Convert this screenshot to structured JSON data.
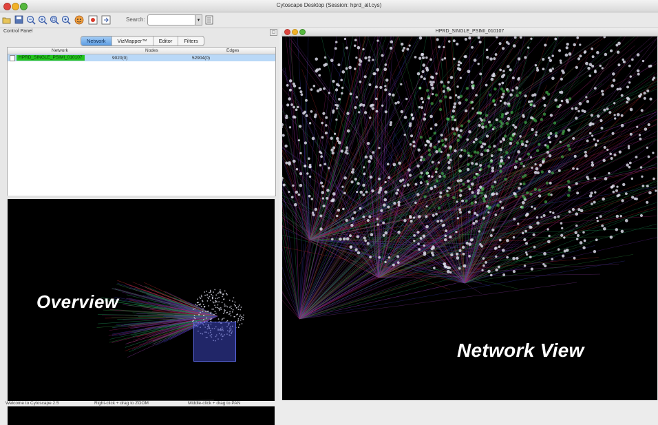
{
  "window": {
    "title": "Cytoscape Desktop (Session: hprd_all.cys)"
  },
  "toolbar": {
    "icons": [
      "open-folder-icon",
      "save-icon",
      "zoom-out-icon",
      "zoom-in-icon",
      "zoom-selected-icon",
      "zoom-fit-icon",
      "vizwiz-icon",
      "layout-icon",
      "export-icon"
    ],
    "search_label": "Search:",
    "search_value": ""
  },
  "control_panel": {
    "title": "Control Panel",
    "tabs": [
      {
        "label": "Network",
        "active": true
      },
      {
        "label": "VizMapper™",
        "active": false
      },
      {
        "label": "Editor",
        "active": false
      },
      {
        "label": "Filters",
        "active": false
      }
    ],
    "table": {
      "headers": [
        "Network",
        "Nodes",
        "Edges"
      ],
      "rows": [
        {
          "network": "HPRD_SINGLE_PSIMI_010107",
          "nodes": "9020(0)",
          "edges": "52904(0)"
        }
      ]
    }
  },
  "overview": {
    "label": "Overview"
  },
  "network_view": {
    "title": "HPRD_SINGLE_PSIMI_010107",
    "label": "Network View"
  },
  "status_bar": {
    "welcome": "Welcome to Cytoscape 2.5",
    "zoom_hint": "Right-click + drag  to  ZOOM",
    "pan_hint": "Middle-click + drag  to  PAN"
  },
  "colors": {
    "network_highlight": "#23c41d",
    "overview_rect": "#3c46be",
    "selected_row": "#b9d8f7"
  }
}
